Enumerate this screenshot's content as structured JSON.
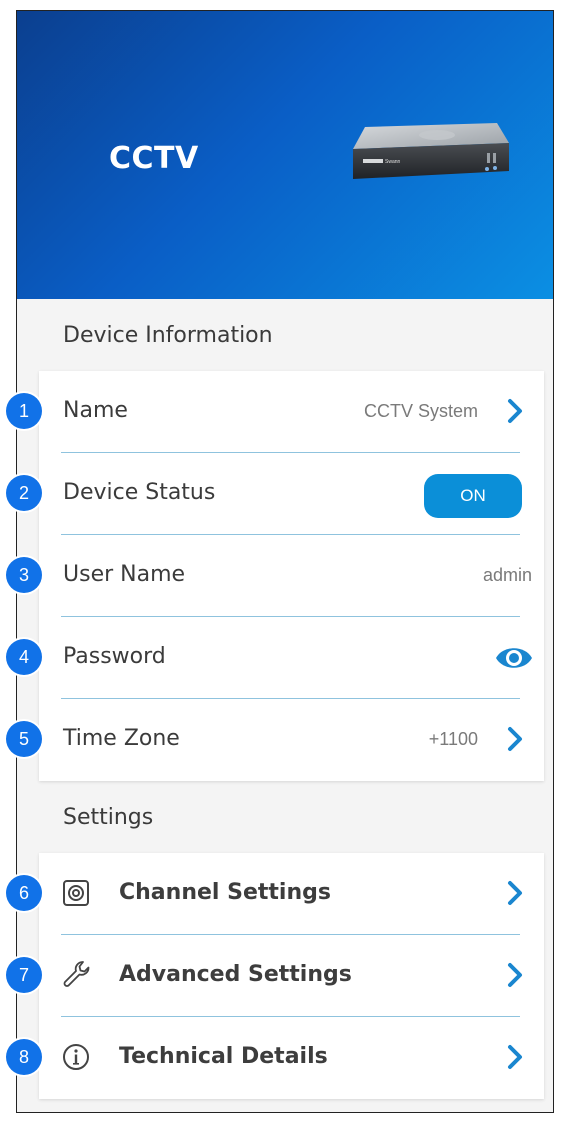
{
  "header": {
    "title": "CCTV",
    "brand": "Swann"
  },
  "device_info": {
    "section_title": "Device Information",
    "rows": [
      {
        "badge": "1",
        "label": "Name",
        "value": "CCTV System",
        "control": "chevron"
      },
      {
        "badge": "2",
        "label": "Device Status",
        "value": "ON",
        "control": "toggle"
      },
      {
        "badge": "3",
        "label": "User Name",
        "value": "admin",
        "control": "none"
      },
      {
        "badge": "4",
        "label": "Password",
        "value": "",
        "control": "eye-icon"
      },
      {
        "badge": "5",
        "label": "Time Zone",
        "value": "+1100",
        "control": "chevron"
      }
    ]
  },
  "settings": {
    "section_title": "Settings",
    "rows": [
      {
        "badge": "6",
        "label": "Channel Settings",
        "icon": "camera-channel-icon"
      },
      {
        "badge": "7",
        "label": "Advanced Settings",
        "icon": "wrench-icon"
      },
      {
        "badge": "8",
        "label": "Technical Details",
        "icon": "info-icon"
      }
    ]
  },
  "colors": {
    "header_start": "#0b3f8f",
    "header_end": "#0b8fe3",
    "accent": "#0b8fd8",
    "badge": "#1172e8",
    "divider": "#8fc3de"
  }
}
